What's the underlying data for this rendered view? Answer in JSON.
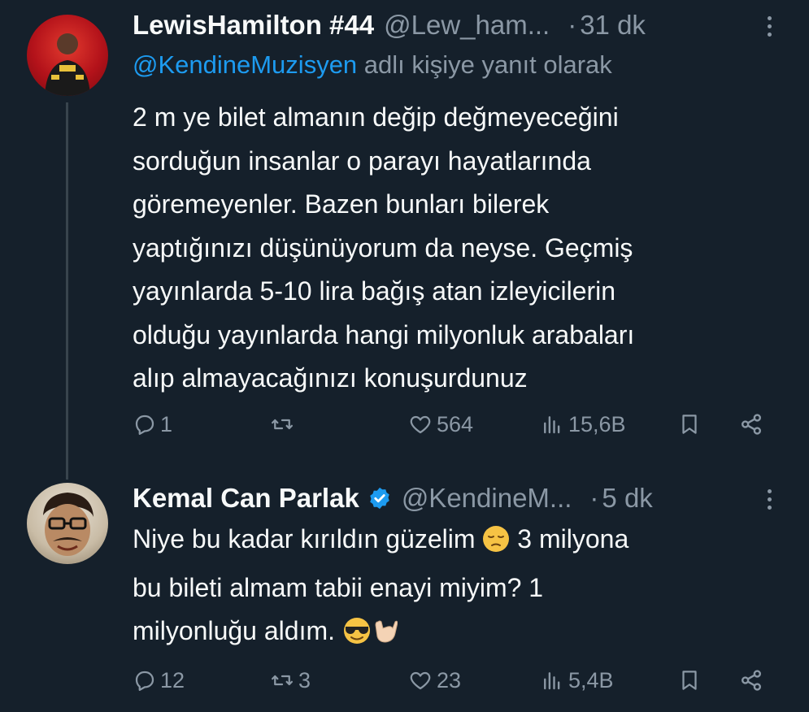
{
  "tweets": [
    {
      "author": "LewisHamilton #44",
      "handle": "@Lew_ham...",
      "separator": "·",
      "time": "31 dk",
      "reply_mention": "@KendineMuzisyen",
      "reply_suffix": " adlı kişiye yanıt olarak",
      "body_lines": [
        "2 m ye bilet almanın değip değmeyeceğini",
        "sorduğun insanlar o parayı hayatlarında",
        "göremeyenler. Bazen bunları bilerek",
        "yaptığınızı düşünüyorum da neyse. Geçmiş",
        "yayınlarda 5-10 lira bağış atan izleyicilerin",
        "olduğu yayınlarda hangi milyonluk arabaları",
        "alıp almayacağınızı konuşurdunuz"
      ],
      "replies": "1",
      "retweets": "",
      "likes": "564",
      "views": "15,6B"
    },
    {
      "author": "Kemal Can Parlak",
      "verified": true,
      "handle": "@KendineM...",
      "separator": "·",
      "time": "5 dk",
      "body_line1_a": "Niye bu kadar kırıldın güzelim ",
      "body_line1_b": " 3 milyona",
      "body_line2": "bu bileti almam tabii enayi miyim? 1",
      "body_line3": "milyonluğu aldım. ",
      "emojis": [
        "pensive-face",
        "smiling-face-with-sunglasses",
        "call-me-hand"
      ],
      "replies": "12",
      "retweets": "3",
      "likes": "23",
      "views": "5,4B"
    }
  ],
  "colors": {
    "background": "#15202b",
    "text": "#f7f9f9",
    "muted": "#8b98a5",
    "link": "#1d9bf0",
    "thread_line": "#38444d"
  }
}
